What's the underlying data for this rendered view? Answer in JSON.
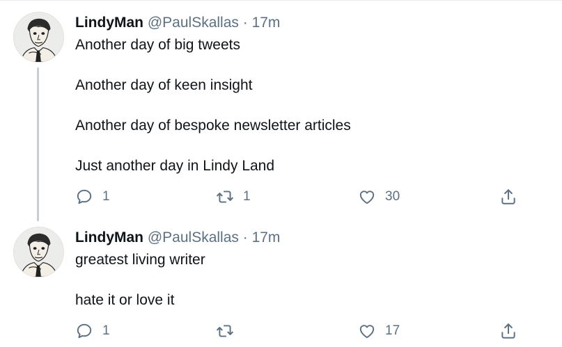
{
  "tweets": [
    {
      "display_name": "LindyMan",
      "handle": "@PaulSkallas",
      "separator": "·",
      "time": "17m",
      "lines": [
        "Another day of big tweets",
        "Another day of keen insight",
        "Another day of bespoke newsletter articles",
        "Just another day in Lindy Land"
      ],
      "reply_count": "1",
      "retweet_count": "1",
      "like_count": "30"
    },
    {
      "display_name": "LindyMan",
      "handle": "@PaulSkallas",
      "separator": "·",
      "time": "17m",
      "lines": [
        "greatest living writer",
        "hate it or love it"
      ],
      "reply_count": "1",
      "retweet_count": "",
      "like_count": "17"
    }
  ],
  "icons": {
    "reply": "reply-icon",
    "retweet": "retweet-icon",
    "like": "heart-icon",
    "share": "share-icon"
  },
  "colors": {
    "text_primary": "#0f1419",
    "text_secondary": "#5b7083",
    "thread_line": "#c4cfd6"
  }
}
